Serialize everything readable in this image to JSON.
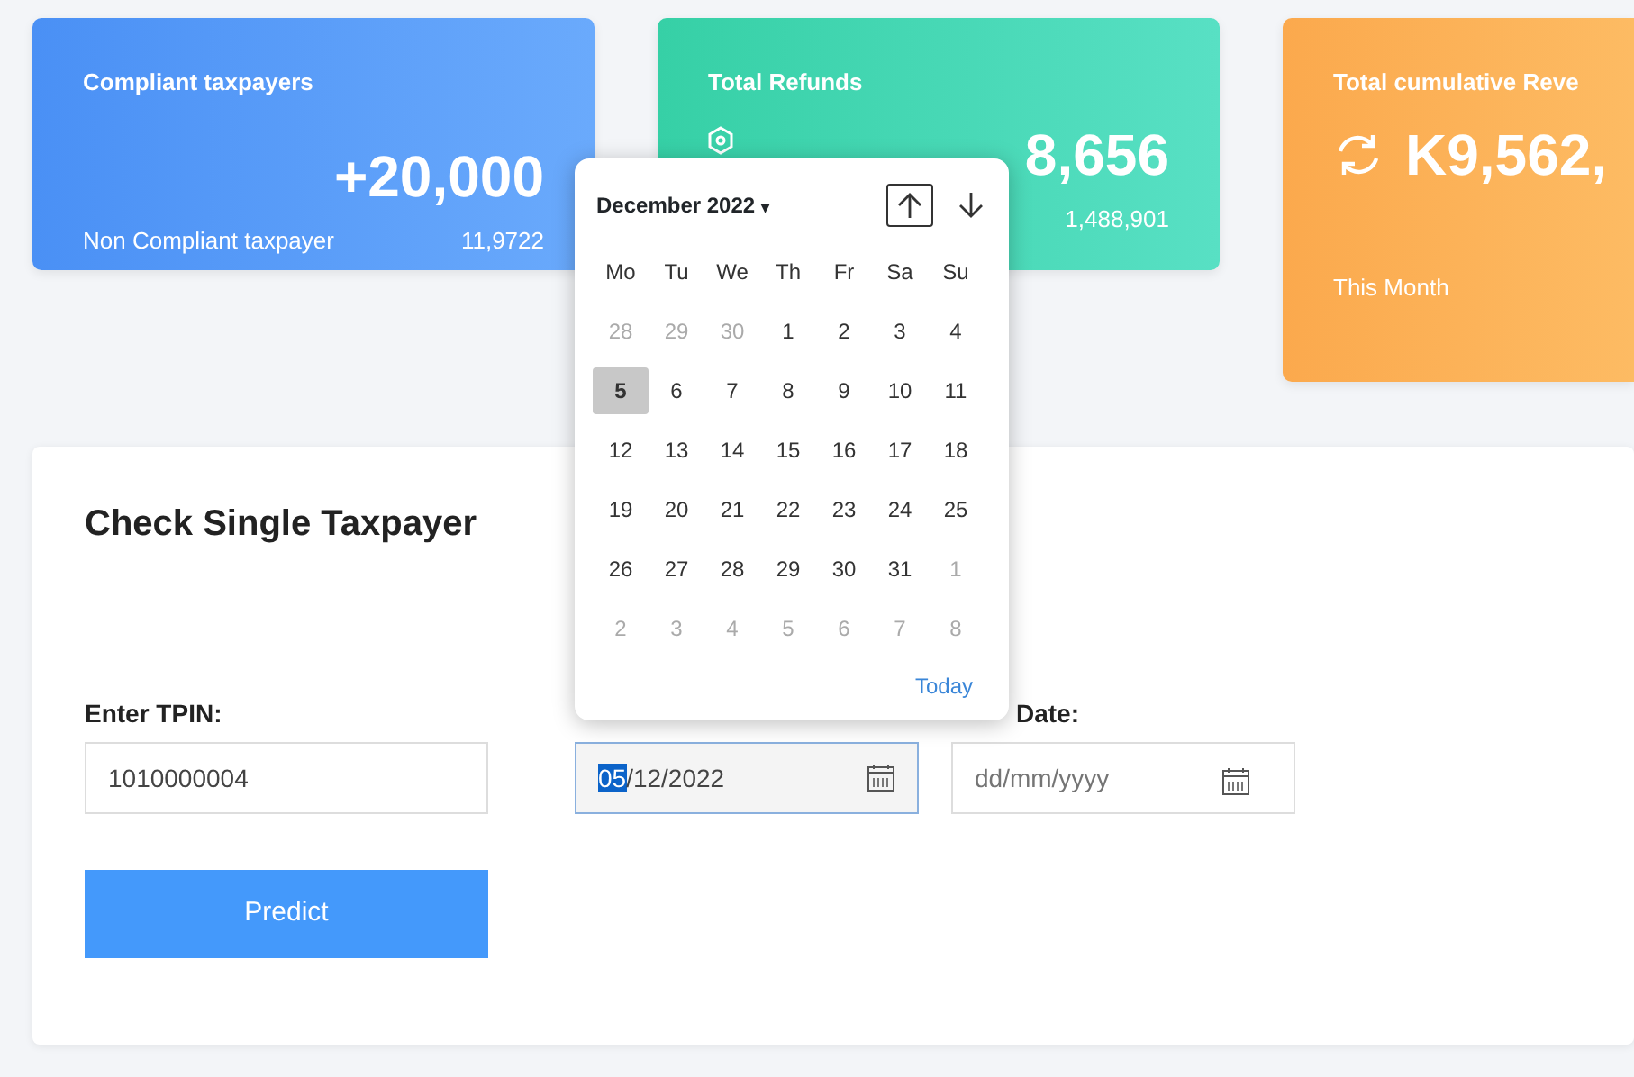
{
  "stat_cards": [
    {
      "kind": "blue",
      "title": "Compliant taxpayers",
      "value": "+20,000",
      "sub_label": "Non Compliant taxpayer",
      "sub_value": "11,9722"
    },
    {
      "kind": "green",
      "title": "Total Refunds",
      "value": "8,656",
      "sub_value": "1,488,901"
    },
    {
      "kind": "orange",
      "title": "Total cumulative Reve",
      "value": "K9,562,",
      "sub_label": "This Month"
    }
  ],
  "form": {
    "title": "Check Single Taxpayer",
    "fields": [
      {
        "label": "Enter TPIN:",
        "value": "1010000004"
      },
      {
        "value_selected": "05",
        "value": "/12/2022",
        "focused": true
      },
      {
        "label": "Date:",
        "placeholder": "dd/mm/yyyy",
        "focused": false
      }
    ],
    "button": "Predict"
  },
  "datepicker": {
    "month": "December 2022",
    "caret": "▾",
    "today": "Today",
    "weekdays": [
      "Mo",
      "Tu",
      "We",
      "Th",
      "Fr",
      "Sa",
      "Su"
    ],
    "days": [
      {
        "d": "28",
        "muted": true,
        "selected": false
      },
      {
        "d": "29",
        "muted": true,
        "selected": false
      },
      {
        "d": "30",
        "muted": true,
        "selected": false
      },
      {
        "d": "1",
        "muted": false,
        "selected": false
      },
      {
        "d": "2",
        "muted": false,
        "selected": false
      },
      {
        "d": "3",
        "muted": false,
        "selected": false
      },
      {
        "d": "4",
        "muted": false,
        "selected": false
      },
      {
        "d": "5",
        "muted": false,
        "selected": true
      },
      {
        "d": "6",
        "muted": false,
        "selected": false
      },
      {
        "d": "7",
        "muted": false,
        "selected": false
      },
      {
        "d": "8",
        "muted": false,
        "selected": false
      },
      {
        "d": "9",
        "muted": false,
        "selected": false
      },
      {
        "d": "10",
        "muted": false,
        "selected": false
      },
      {
        "d": "11",
        "muted": false,
        "selected": false
      },
      {
        "d": "12",
        "muted": false,
        "selected": false
      },
      {
        "d": "13",
        "muted": false,
        "selected": false
      },
      {
        "d": "14",
        "muted": false,
        "selected": false
      },
      {
        "d": "15",
        "muted": false,
        "selected": false
      },
      {
        "d": "16",
        "muted": false,
        "selected": false
      },
      {
        "d": "17",
        "muted": false,
        "selected": false
      },
      {
        "d": "18",
        "muted": false,
        "selected": false
      },
      {
        "d": "19",
        "muted": false,
        "selected": false
      },
      {
        "d": "20",
        "muted": false,
        "selected": false
      },
      {
        "d": "21",
        "muted": false,
        "selected": false
      },
      {
        "d": "22",
        "muted": false,
        "selected": false
      },
      {
        "d": "23",
        "muted": false,
        "selected": false
      },
      {
        "d": "24",
        "muted": false,
        "selected": false
      },
      {
        "d": "25",
        "muted": false,
        "selected": false
      },
      {
        "d": "26",
        "muted": false,
        "selected": false
      },
      {
        "d": "27",
        "muted": false,
        "selected": false
      },
      {
        "d": "28",
        "muted": false,
        "selected": false
      },
      {
        "d": "29",
        "muted": false,
        "selected": false
      },
      {
        "d": "30",
        "muted": false,
        "selected": false
      },
      {
        "d": "31",
        "muted": false,
        "selected": false
      },
      {
        "d": "1",
        "muted": true,
        "selected": false
      },
      {
        "d": "2",
        "muted": true,
        "selected": false
      },
      {
        "d": "3",
        "muted": true,
        "selected": false
      },
      {
        "d": "4",
        "muted": true,
        "selected": false
      },
      {
        "d": "5",
        "muted": true,
        "selected": false
      },
      {
        "d": "6",
        "muted": true,
        "selected": false
      },
      {
        "d": "7",
        "muted": true,
        "selected": false
      },
      {
        "d": "8",
        "muted": true,
        "selected": false
      }
    ]
  }
}
